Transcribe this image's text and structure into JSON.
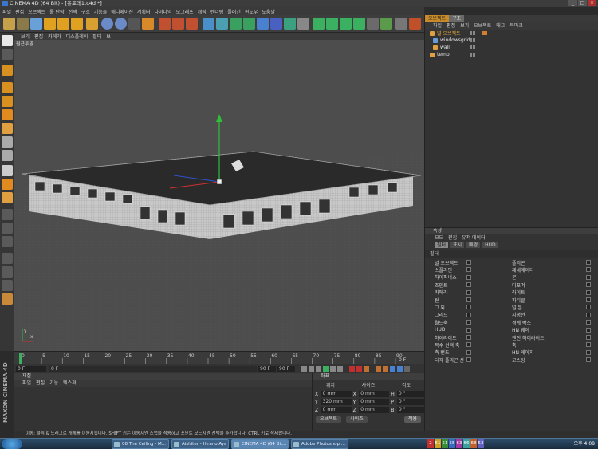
{
  "window": {
    "title": "CINEMA 4D (64 Bit) - [유포데1.c4d *]",
    "min": "_",
    "max": "□",
    "close": "×"
  },
  "menubar": [
    "파일",
    "편집",
    "오브젝트",
    "툴 탄탁",
    "선택",
    "구조",
    "기능들",
    "애니메이션",
    "계획터",
    "다이나믹",
    "모그래프",
    "캐릭",
    "렌더링",
    "플러긴",
    "윈도우",
    "도움말"
  ],
  "viewport": {
    "menu": [
      "보기",
      "편집",
      "카메라",
      "디스플레이",
      "필터",
      "보"
    ],
    "label": "원근투영",
    "axis_x": "x",
    "axis_y": "y"
  },
  "timeline": {
    "ticks": [
      "0",
      "5",
      "10",
      "15",
      "20",
      "25",
      "30",
      "35",
      "40",
      "45",
      "50",
      "55",
      "60",
      "65",
      "70",
      "75",
      "80",
      "85",
      "90"
    ],
    "current_frame": "0 F",
    "start": "0 F",
    "end": "90 F",
    "end2": "90 F",
    "fps": "0 F"
  },
  "materials": {
    "title": "재질",
    "menu": [
      "파일",
      "편집",
      "기능",
      "텍스쳐"
    ]
  },
  "coordinates": {
    "title": "좌표",
    "col_pos": "위치",
    "col_size": "사이즈",
    "col_rot": "각도",
    "rows": [
      {
        "axis": "X",
        "pos": "0 mm",
        "size": "0 mm",
        "rot_axis": "H",
        "rot": "0 °"
      },
      {
        "axis": "Y",
        "pos": "320 mm",
        "size": "0 mm",
        "rot_axis": "P",
        "rot": "0 °"
      },
      {
        "axis": "Z",
        "pos": "0 mm",
        "size": "0 mm",
        "rot_axis": "B",
        "rot": "0 °"
      }
    ],
    "mode": "오브젝트",
    "size_mode": "사이즈",
    "apply": "적용"
  },
  "objects": {
    "tabs": [
      "오브젝트",
      "구조"
    ],
    "menu": [
      "파일",
      "편집",
      "보기",
      "오브젝트",
      "태그",
      "북마크"
    ],
    "items": [
      {
        "name": "널 오브젝트",
        "selected": true
      },
      {
        "name": "windowsgrid",
        "selected": false
      },
      {
        "name": "wall",
        "selected": false
      },
      {
        "name": "temp",
        "selected": false
      }
    ]
  },
  "attributes": {
    "title": "속성",
    "menu": [
      "모드",
      "편집",
      "유저 데이터"
    ],
    "subtabs": [
      "필터",
      "표시",
      "배경",
      "HUD"
    ],
    "section": "필터",
    "filters": [
      [
        "널 오브젝트",
        "폴리곤"
      ],
      [
        "스플라인",
        "제네레이터"
      ],
      [
        "하이퍼너스",
        "본"
      ],
      [
        "조인트",
        "디포머"
      ],
      [
        "카메라",
        "라이트"
      ],
      [
        "씬",
        "파티클"
      ],
      [
        "그 외",
        "널 본"
      ],
      [
        "그리드",
        "지평선"
      ],
      [
        "월드축",
        "경계 박스"
      ],
      [
        "HUD",
        "HN 웨이"
      ],
      [
        "하이라이트",
        "엔진 하이라이트"
      ],
      [
        "복수 선택 축",
        "축"
      ],
      [
        "축 밴드",
        "HN 케이지"
      ],
      [
        "다각 폴리곤 선",
        "고스팅"
      ]
    ]
  },
  "statusbar": "이동: 클릭 & 드래그로 개체를 이동시킵니다. SHIFT 키는 이동시엔 스냅을 적용하고 포인트 모드시엔 선택을 추가합니다. CTRL 키로 삭제합니다.",
  "maxon": "MAXON CINEMA 4D",
  "taskbar": {
    "items": [
      "08 The Ceiling - M...",
      "Aishiter - Hirano Aya",
      "CINEMA 4D (64 Bit...",
      "Adobe Photoshop ..."
    ],
    "tray": [
      "2",
      "51",
      "51",
      "55",
      "63",
      "66",
      "68",
      "53"
    ],
    "clock": "오후 4:08"
  },
  "colors": {
    "accent": "#c98a2a",
    "y_axis": "#2fbf3a",
    "x_axis": "#d03030",
    "z_axis": "#3050d0",
    "viewport": "#4b4b4b"
  }
}
